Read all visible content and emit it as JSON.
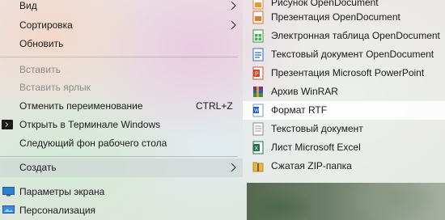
{
  "context_menu": {
    "items": [
      {
        "label": "Вид"
      },
      {
        "label": "Сортировка"
      },
      {
        "label": "Обновить"
      },
      {
        "label": "Вставить"
      },
      {
        "label": "Вставить ярлык"
      },
      {
        "label": "Отменить переименование",
        "shortcut": "CTRL+Z"
      },
      {
        "label": "Открыть в Терминале Windows"
      },
      {
        "label": "Следующий фон рабочего стола"
      },
      {
        "label": "Создать"
      }
    ]
  },
  "submenu": {
    "items": [
      {
        "label": "Рисунок OpenDocument",
        "icon": "odg-drawing-icon"
      },
      {
        "label": "Презентация OpenDocument",
        "icon": "odp-presentation-icon"
      },
      {
        "label": "Электронная таблица OpenDocument",
        "icon": "ods-spreadsheet-icon"
      },
      {
        "label": "Текстовый документ OpenDocument",
        "icon": "odt-text-icon"
      },
      {
        "label": "Презентация Microsoft PowerPoint",
        "icon": "pptx-icon"
      },
      {
        "label": "Архив WinRAR",
        "icon": "winrar-icon"
      },
      {
        "label": "Формат RTF",
        "icon": "rtf-document-icon"
      },
      {
        "label": "Текстовый документ",
        "icon": "text-document-icon"
      },
      {
        "label": "Лист Microsoft Excel",
        "icon": "excel-icon"
      },
      {
        "label": "Сжатая ZIP-папка",
        "icon": "zip-folder-icon"
      }
    ]
  },
  "lower_menu": {
    "items": [
      {
        "label": "Параметры экрана",
        "icon": "display-settings-icon"
      },
      {
        "label": "Персонализация",
        "icon": "personalization-icon"
      }
    ]
  }
}
